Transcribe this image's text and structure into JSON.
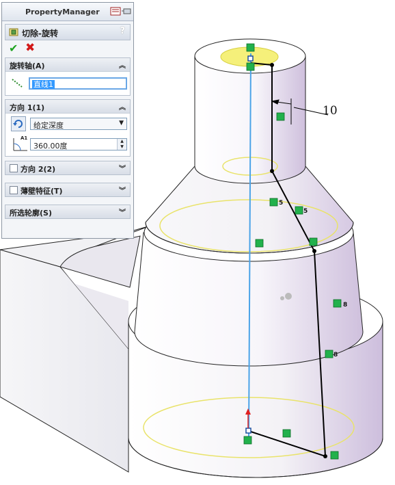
{
  "panel": {
    "title": "PropertyManager",
    "feature_name": "切除-旋转",
    "help": "?",
    "ok": "✔",
    "cancel": "✖"
  },
  "groups": {
    "axis": {
      "label": "旋转轴(A)",
      "value": "直线1"
    },
    "direction1": {
      "label": "方向 1(1)",
      "end_condition": "给定深度",
      "angle": "360.00度",
      "angle_icon_label": "A1"
    },
    "direction2": {
      "label": "方向 2(2)"
    },
    "thin": {
      "label": "薄壁特征(T)"
    },
    "contours": {
      "label": "所选轮廓(S)"
    }
  },
  "sketch": {
    "dimension": "10",
    "tags": [
      "5",
      "5",
      "8",
      "8"
    ]
  },
  "colors": {
    "sketch_line": "#000000",
    "axis_line": "#4aa3e8",
    "highlight": "#f5f07a",
    "relation_green": "#22b14c",
    "model_face": "#ffffff",
    "model_shade": "#d9cfe6"
  }
}
